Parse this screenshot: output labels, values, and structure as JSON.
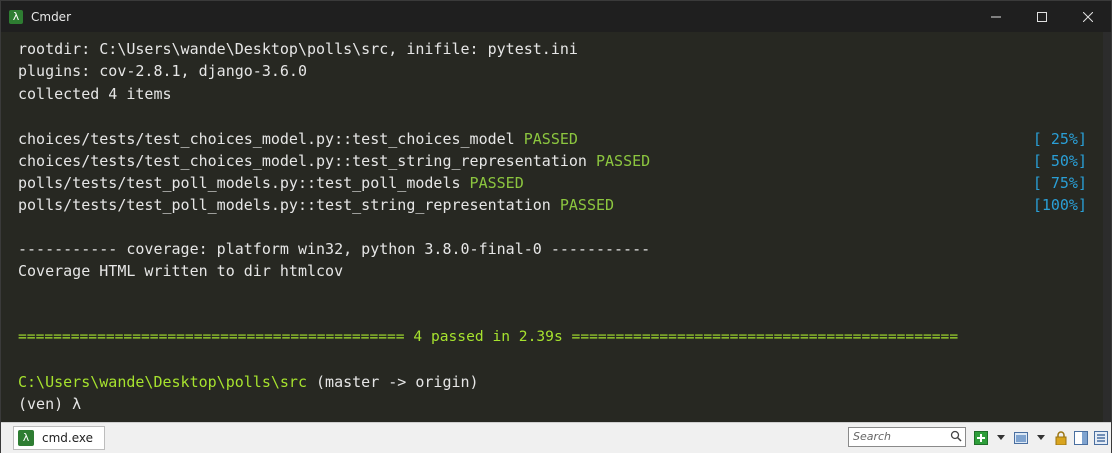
{
  "window": {
    "title": "Cmder",
    "app_icon": "λ"
  },
  "terminal": {
    "lines": {
      "l1": "rootdir: C:\\Users\\wande\\Desktop\\polls\\src, inifile: pytest.ini",
      "l2": "plugins: cov-2.8.1, django-3.6.0",
      "l3": "collected 4 items"
    },
    "tests": [
      {
        "name": "choices/tests/test_choices_model.py::test_choices_model",
        "status": "PASSED",
        "progress": "[ 25%]"
      },
      {
        "name": "choices/tests/test_choices_model.py::test_string_representation",
        "status": "PASSED",
        "progress": "[ 50%]"
      },
      {
        "name": "polls/tests/test_poll_models.py::test_poll_models",
        "status": "PASSED",
        "progress": "[ 75%]"
      },
      {
        "name": "polls/tests/test_poll_models.py::test_string_representation",
        "status": "PASSED",
        "progress": "[100%]"
      }
    ],
    "coverage_header": "----------- coverage: platform win32, python 3.8.0-final-0 -----------",
    "coverage_written": "Coverage HTML written to dir htmlcov",
    "summary": "============================================ 4 passed in 2.39s ============================================",
    "prompt_path": "C:\\Users\\wande\\Desktop\\polls\\src",
    "prompt_branch": " (master -> origin)",
    "prompt_env": "(ven) λ"
  },
  "statusbar": {
    "tab_label": "cmd.exe",
    "tab_icon": "λ",
    "search_placeholder": "Search"
  },
  "colors": {
    "background": "#272822",
    "passed": "#8cc63f",
    "progress": "#2a9fd6",
    "summary": "#a6e22e"
  }
}
